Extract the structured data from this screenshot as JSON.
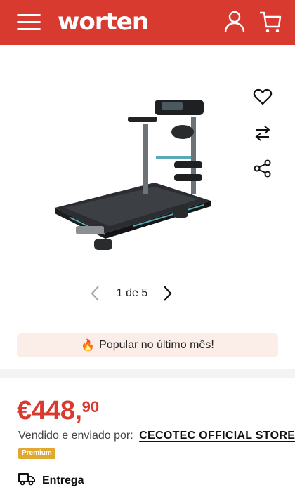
{
  "header": {
    "logo": "worten",
    "accent_color": "#d93a30",
    "icons": [
      "menu-icon",
      "user-icon",
      "cart-icon"
    ]
  },
  "gallery": {
    "pager_text": "1 de 5",
    "current_image": 1,
    "total_images": 5,
    "side_icons": [
      "heart-icon",
      "compare-icon",
      "share-icon"
    ]
  },
  "popular": {
    "emoji": "🔥",
    "label": "Popular no último mês!"
  },
  "product": {
    "price_main": "€448,",
    "price_cents": "90",
    "seller_label": "Vendido e enviado por:",
    "seller_name": "CECOTEC OFFICIAL STORE",
    "seller_badge": "Premium",
    "delivery_label": "Entrega"
  }
}
